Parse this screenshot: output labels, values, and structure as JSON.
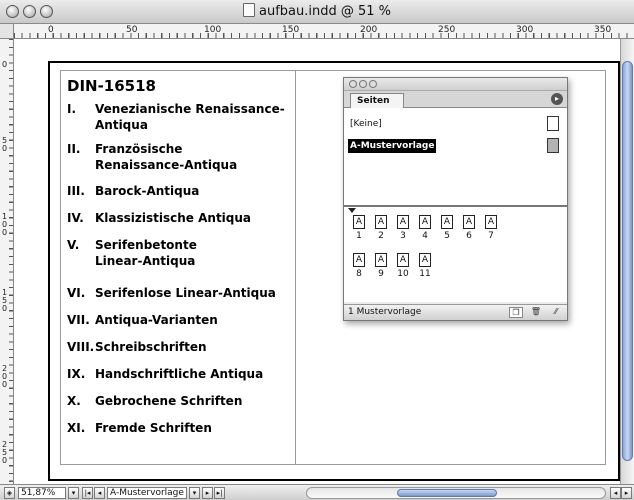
{
  "window": {
    "title": "aufbau.indd @ 51 %"
  },
  "rulers": {
    "horizontal_labels": [
      "0",
      "50",
      "100",
      "150",
      "200",
      "250",
      "300",
      "350"
    ],
    "vertical_labels": [
      "0",
      "50",
      "100",
      "150",
      "200",
      "250"
    ]
  },
  "document": {
    "heading": "DIN-16518",
    "items": [
      {
        "num": "I.",
        "text": "Venezianische Renaissance-Antiqua"
      },
      {
        "num": "II.",
        "text": "Französische Renaissance-Antiqua"
      },
      {
        "num": "III.",
        "text": "Barock-Antiqua"
      },
      {
        "num": "IV.",
        "text": "Klassizistische Antiqua"
      },
      {
        "num": "V.",
        "text": "Serifenbetonte Linear-Antiqua"
      },
      {
        "num": "VI.",
        "text": "Serifenlose Linear-Antiqua"
      },
      {
        "num": "VII.",
        "text": "Antiqua-Varianten"
      },
      {
        "num": "VIII.",
        "text": "Schreibschriften"
      },
      {
        "num": "IX.",
        "text": "Handschriftliche Antiqua"
      },
      {
        "num": "X.",
        "text": "Gebrochene Schriften"
      },
      {
        "num": "XI.",
        "text": "Fremde Schriften"
      }
    ]
  },
  "pages_panel": {
    "tab_label": "Seiten",
    "masters": [
      {
        "label": "[Keine]",
        "selected": false
      },
      {
        "label": "A-Mustervorlage",
        "selected": true
      }
    ],
    "page_icon_letter": "A",
    "pages": [
      "1",
      "2",
      "3",
      "4",
      "5",
      "6",
      "7",
      "8",
      "9",
      "10",
      "11"
    ],
    "footer_text": "1 Mustervorlage"
  },
  "statusbar": {
    "zoom": "51,87%",
    "page_selector": "A-Mustervorlage"
  },
  "icons": {
    "doc": "document-icon",
    "panel_menu": "panel-menu-icon",
    "new_page": "new-page-icon",
    "delete_page": "trash-icon"
  }
}
